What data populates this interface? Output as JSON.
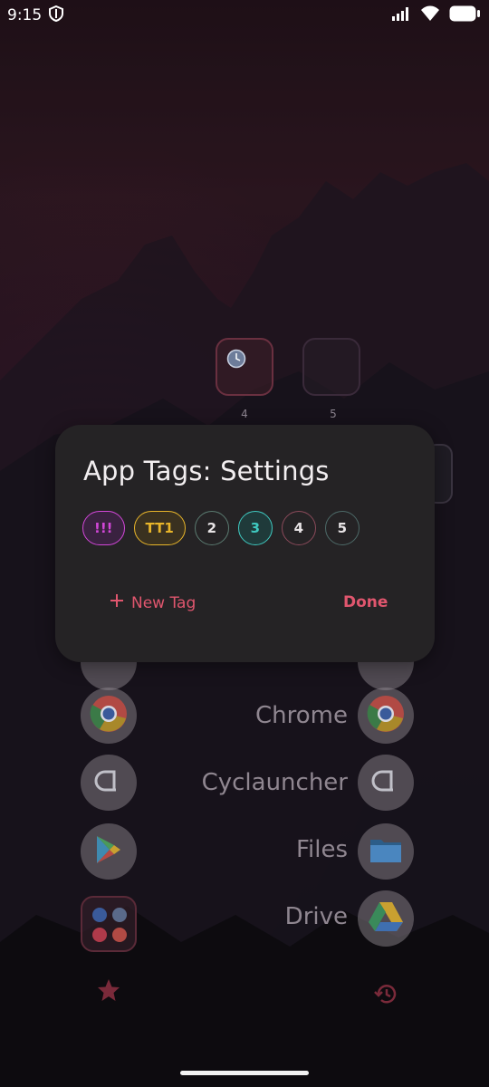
{
  "status": {
    "time": "9:15"
  },
  "folders": [
    {
      "label": "4"
    },
    {
      "label": "5"
    }
  ],
  "apps": [
    {
      "name": "Chrome"
    },
    {
      "name": "Cyclauncher"
    },
    {
      "name": "Files"
    },
    {
      "name": "Drive"
    }
  ],
  "dialog": {
    "title": "App Tags: Settings",
    "tags": [
      {
        "label": "!!!",
        "color": "#d247d8",
        "fill": "#3a2240",
        "selected": true
      },
      {
        "label": "TT1",
        "color": "#e8b52a",
        "fill": "#3a3120",
        "selected": true
      },
      {
        "label": "2",
        "color": "#5a7a70",
        "fill": "#252325",
        "selected": false
      },
      {
        "label": "3",
        "color": "#3fc9c0",
        "fill": "#1f3a3a",
        "selected": true
      },
      {
        "label": "4",
        "color": "#8a4a5a",
        "fill": "#252325",
        "selected": false
      },
      {
        "label": "5",
        "color": "#4d6a68",
        "fill": "#252325",
        "selected": false
      }
    ],
    "new_tag_label": "New Tag",
    "done_label": "Done"
  },
  "accent": "#e0566e"
}
